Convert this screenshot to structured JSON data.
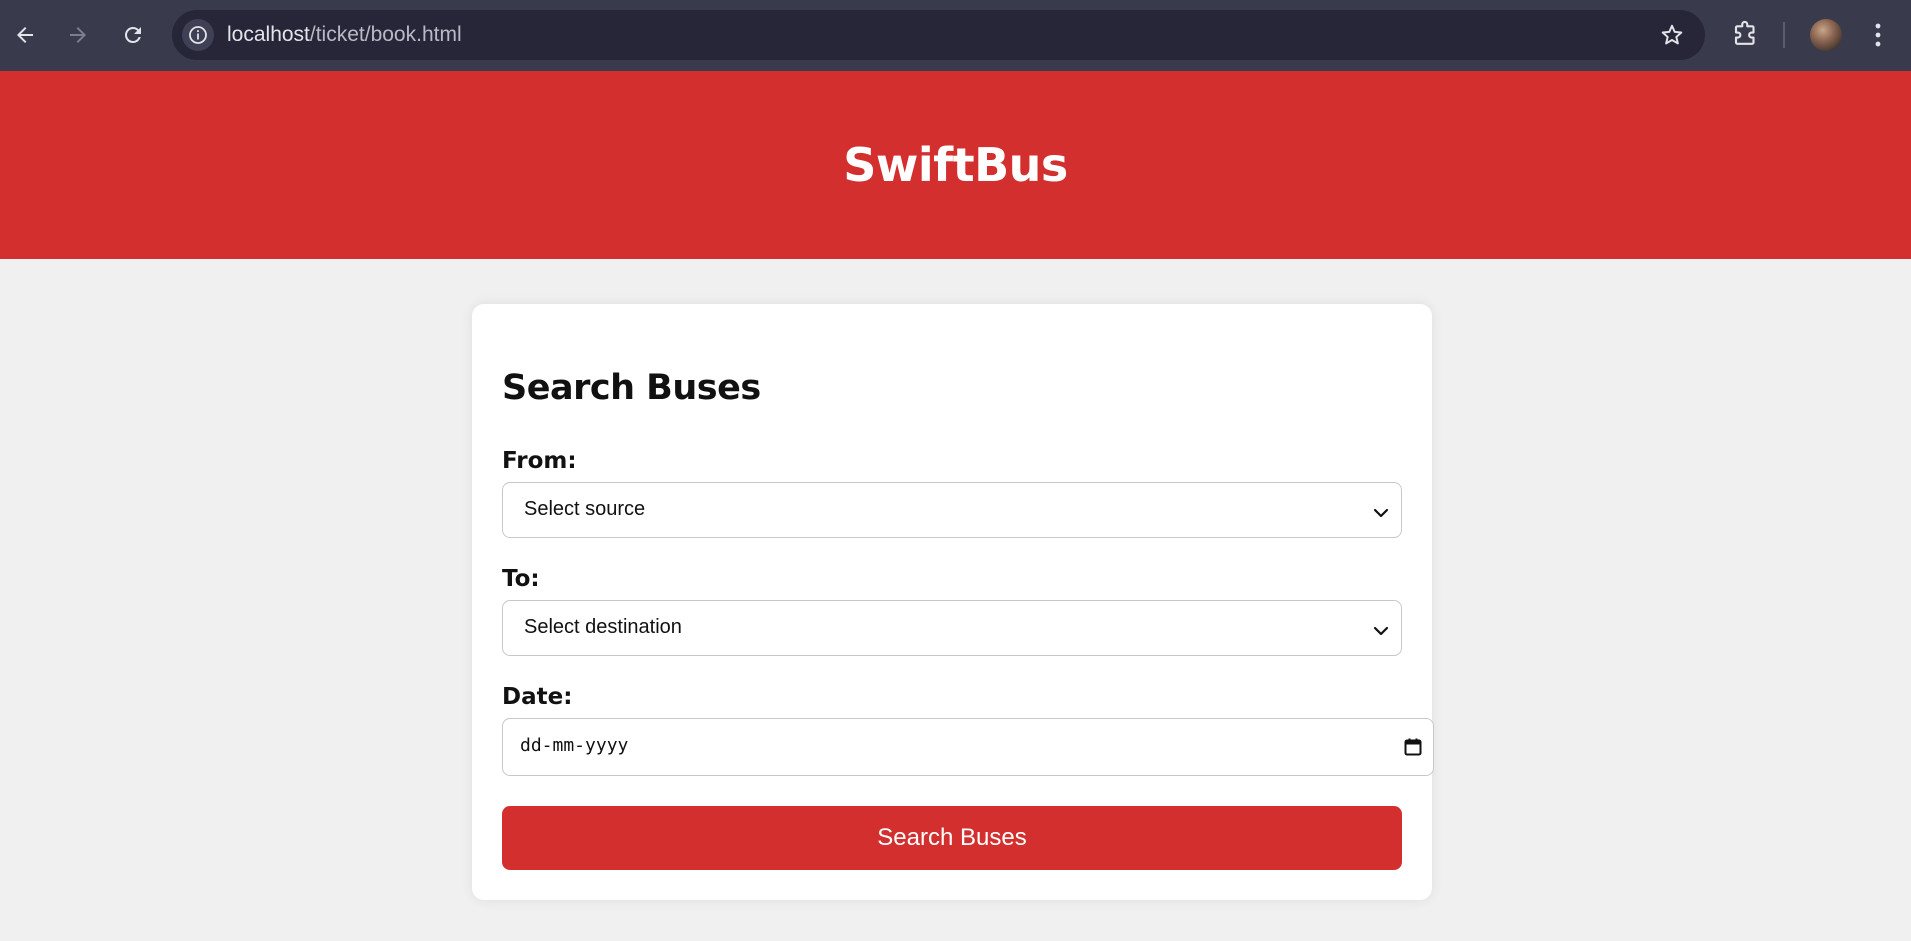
{
  "browser": {
    "url_host": "localhost",
    "url_path": "/ticket/book.html"
  },
  "header": {
    "site_title": "SwiftBus"
  },
  "form": {
    "title": "Search Buses",
    "from_label": "From:",
    "from_selected": "Select source",
    "to_label": "To:",
    "to_selected": "Select destination",
    "date_label": "Date:",
    "date_placeholder": "dd-mm-yyyy",
    "submit_label": "Search Buses"
  },
  "colors": {
    "brand": "#d32f2f",
    "page_bg": "#f0f0f0",
    "card_bg": "#ffffff",
    "chrome_bg": "#3a3a4d"
  }
}
